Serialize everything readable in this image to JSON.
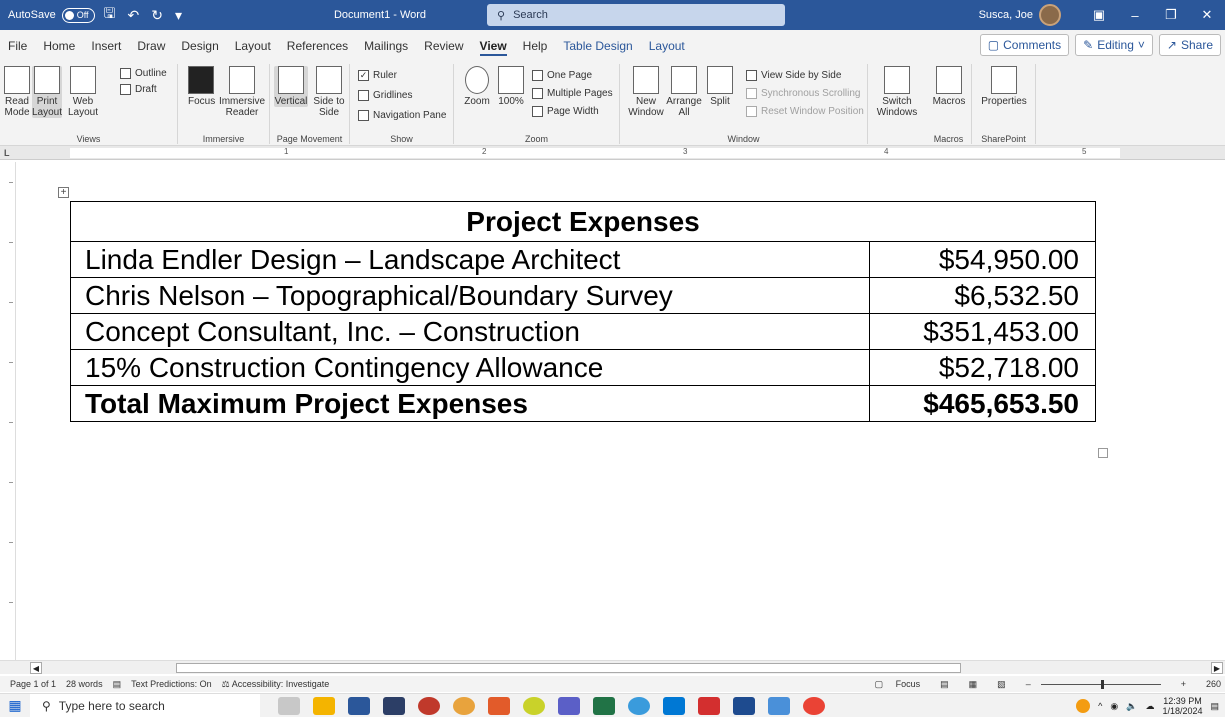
{
  "titlebar": {
    "autosave_label": "AutoSave",
    "autosave_state": "Off",
    "doc_title": "Document1  -  Word",
    "search_placeholder": "Search",
    "user_name": "Susca, Joe"
  },
  "menu": {
    "tabs": [
      "File",
      "Home",
      "Insert",
      "Draw",
      "Design",
      "Layout",
      "References",
      "Mailings",
      "Review",
      "View",
      "Help",
      "Table Design",
      "Layout"
    ],
    "active_tab": "View",
    "comments_label": "Comments",
    "editing_label": "Editing",
    "share_label": "Share"
  },
  "ribbon": {
    "views": {
      "read_mode": "Read Mode",
      "print_layout": "Print Layout",
      "web_layout": "Web Layout",
      "outline": "Outline",
      "draft": "Draft",
      "label": "Views"
    },
    "immersive": {
      "focus": "Focus",
      "immersive_reader": "Immersive Reader",
      "label": "Immersive"
    },
    "page_movement": {
      "vertical": "Vertical",
      "side_to_side": "Side to Side",
      "label": "Page Movement"
    },
    "show": {
      "ruler": "Ruler",
      "gridlines": "Gridlines",
      "navigation_pane": "Navigation Pane",
      "label": "Show"
    },
    "zoom": {
      "zoom": "Zoom",
      "zoom_100": "100%",
      "one_page": "One Page",
      "multiple_pages": "Multiple Pages",
      "page_width": "Page Width",
      "label": "Zoom"
    },
    "window": {
      "new_window": "New Window",
      "arrange_all": "Arrange All",
      "split": "Split",
      "view_side_by_side": "View Side by Side",
      "sync_scrolling": "Synchronous Scrolling",
      "reset_position": "Reset Window Position",
      "switch_windows": "Switch Windows",
      "label": "Window"
    },
    "macros": {
      "macros": "Macros",
      "label": "Macros"
    },
    "sharepoint": {
      "properties": "Properties",
      "label": "SharePoint"
    }
  },
  "ruler": {
    "numbers": [
      "1",
      "2",
      "3",
      "4",
      "5"
    ]
  },
  "document": {
    "table_title": "Project Expenses",
    "rows": [
      {
        "item": "Linda Endler Design – Landscape Architect",
        "amount": "$54,950.00"
      },
      {
        "item": "Chris Nelson – Topographical/Boundary Survey",
        "amount": "$6,532.50"
      },
      {
        "item": "Concept Consultant, Inc. – Construction",
        "amount": "$351,453.00"
      },
      {
        "item": "15% Construction Contingency Allowance",
        "amount": "$52,718.00"
      }
    ],
    "total": {
      "item": "Total Maximum Project Expenses",
      "amount": "$465,653.50"
    }
  },
  "statusbar": {
    "page": "Page 1 of 1",
    "words": "28 words",
    "text_predictions": "Text Predictions: On",
    "accessibility": "Accessibility: Investigate",
    "focus": "Focus",
    "zoom_level": "260"
  },
  "taskbar": {
    "search_placeholder": "Type here to search",
    "time": "12:39 PM",
    "date": "1/18/2024"
  }
}
